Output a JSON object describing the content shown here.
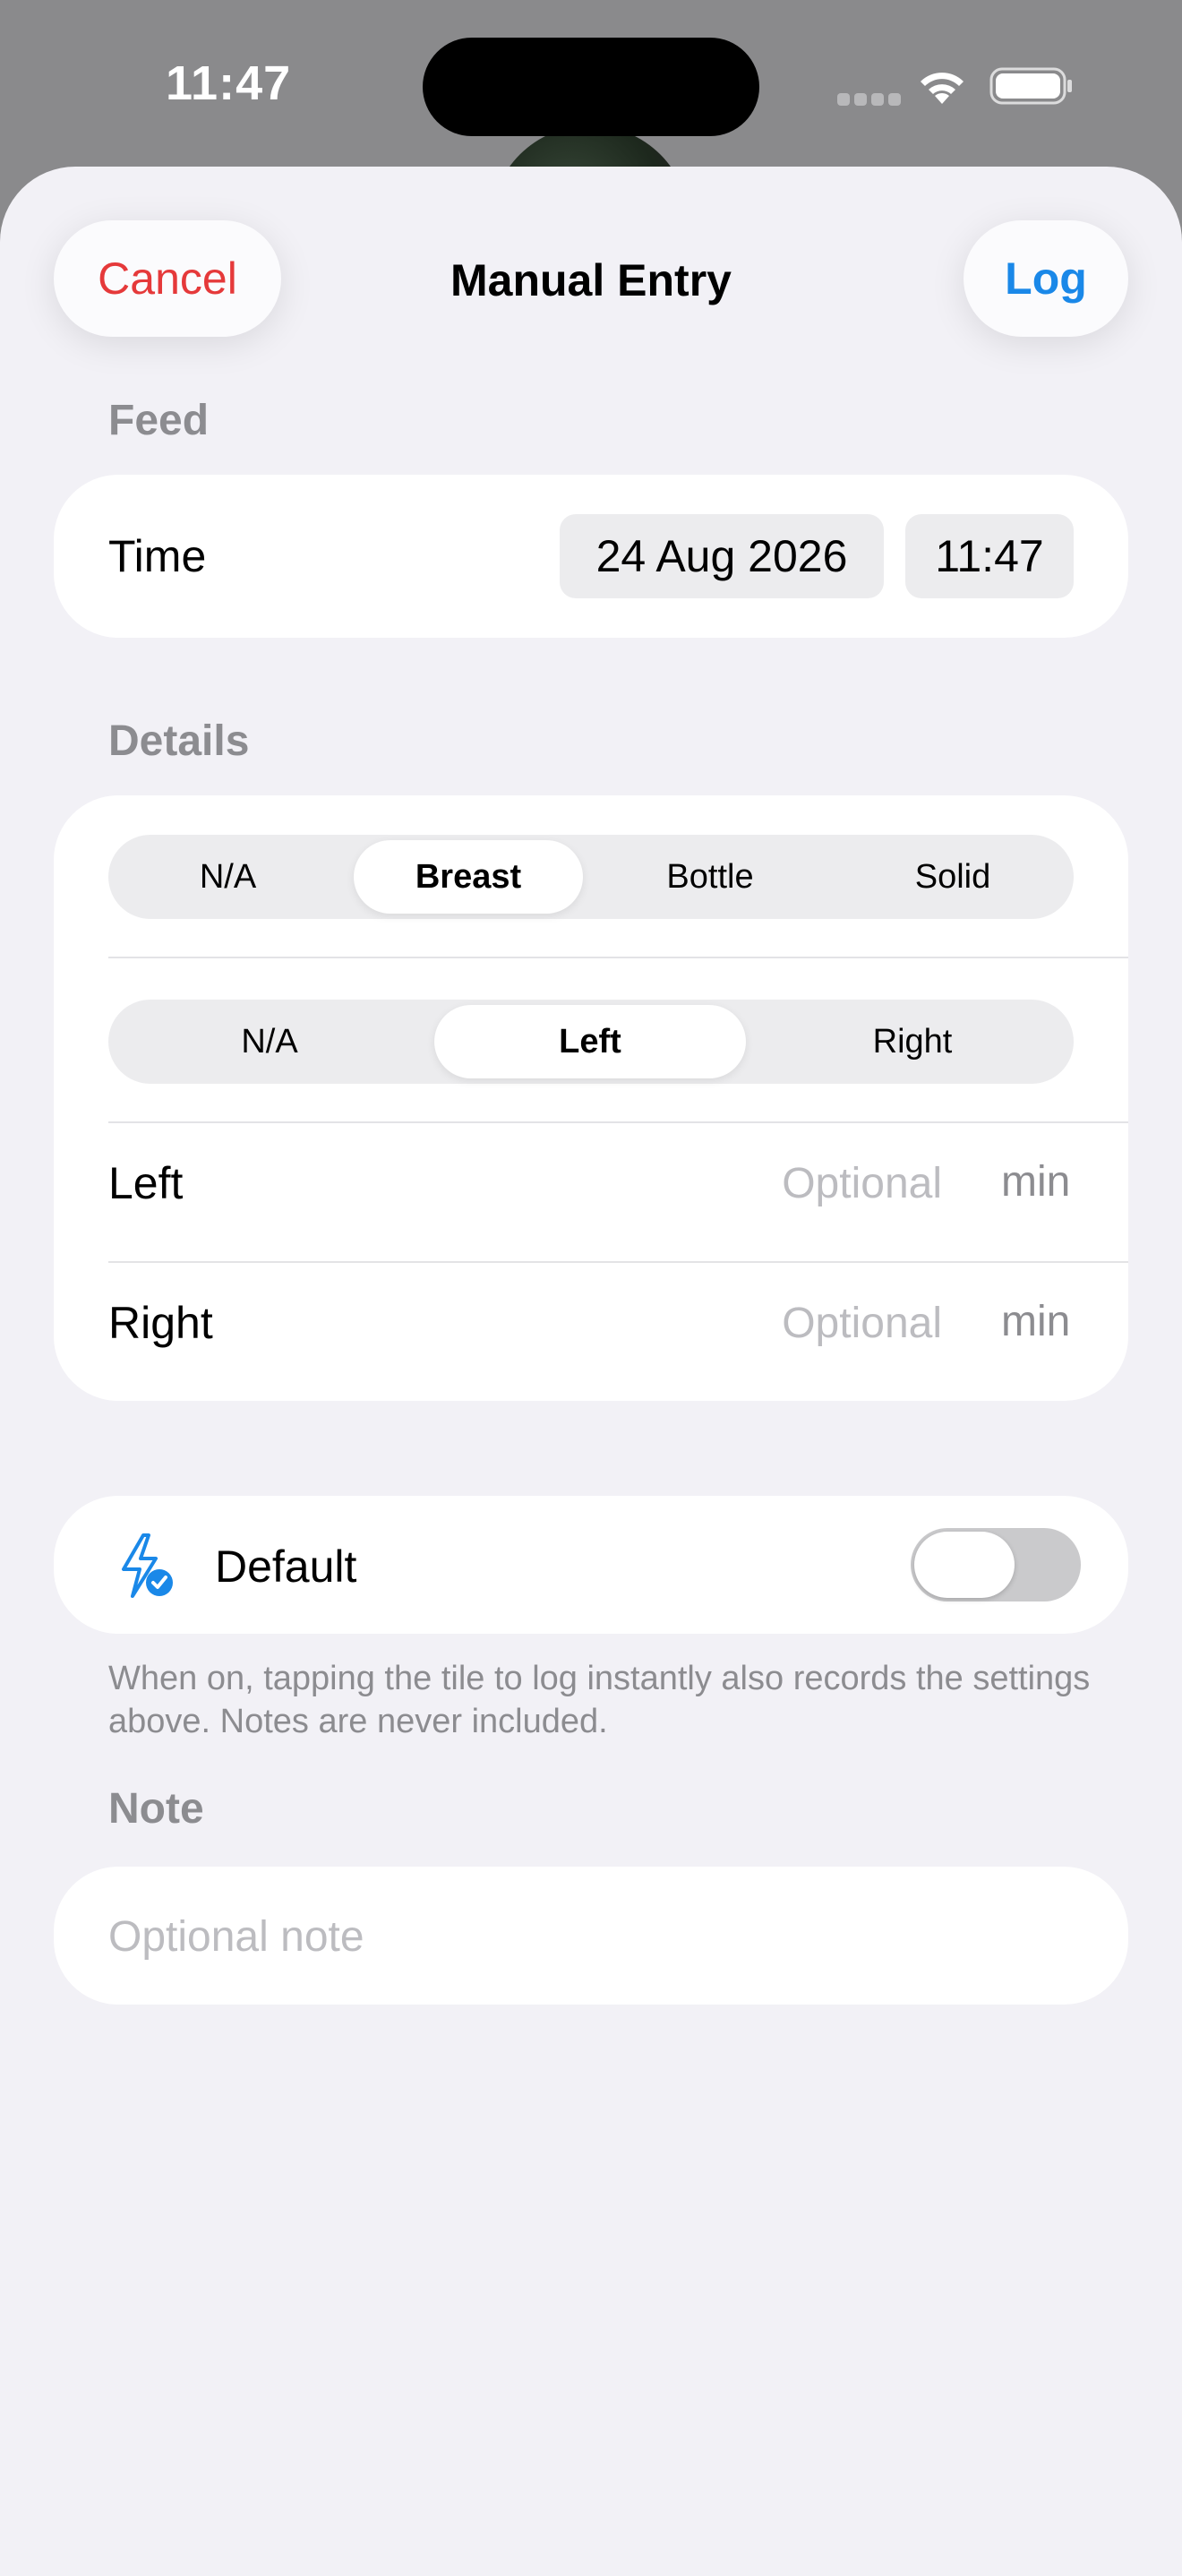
{
  "status_bar": {
    "time": "11:47"
  },
  "sheet": {
    "title": "Manual Entry",
    "cancel_label": "Cancel",
    "log_label": "Log"
  },
  "feed": {
    "section_label": "Feed",
    "time_label": "Time",
    "date_value": "24 Aug 2026",
    "time_value": "11:47"
  },
  "details": {
    "section_label": "Details",
    "type_options": [
      "N/A",
      "Breast",
      "Bottle",
      "Solid"
    ],
    "type_selected": "Breast",
    "side_options": [
      "N/A",
      "Left",
      "Right"
    ],
    "side_selected": "Left",
    "left_label": "Left",
    "right_label": "Right",
    "duration_placeholder": "Optional",
    "duration_unit": "min"
  },
  "default_setting": {
    "label": "Default",
    "icon": "bolt-check-icon",
    "enabled": false,
    "footnote": "When on, tapping the tile to log instantly also records the settings above. Notes are never included."
  },
  "note": {
    "section_label": "Note",
    "placeholder": "Optional note"
  },
  "colors": {
    "cancel": "#e5393a",
    "accent": "#1a88e8",
    "sheet_background": "#f2f1f6",
    "toggle_off": "#cacacc"
  }
}
